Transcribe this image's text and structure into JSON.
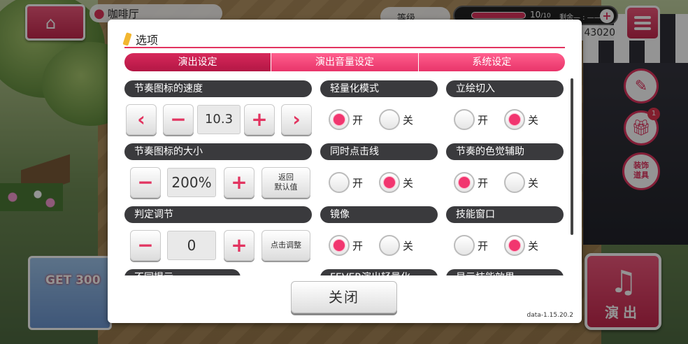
{
  "hud": {
    "location": "咖啡厅",
    "level_label": "等级",
    "stamina": "10",
    "stamina_max": "/10",
    "stamina_rest": "剩余— : ——",
    "coins": "43020",
    "banner_text": "GET 300",
    "side_btn_3": "装饰\n道具",
    "badge_count": "1",
    "perform_label": "演出"
  },
  "dialog": {
    "title": "选项",
    "tabs": [
      {
        "label": "演出设定",
        "active": true
      },
      {
        "label": "演出音量设定",
        "active": false
      },
      {
        "label": "系统设定",
        "active": false
      }
    ],
    "sections": {
      "note_speed": {
        "header": "节奏图标的速度",
        "value": "10.3"
      },
      "note_size": {
        "header": "节奏图标的大小",
        "value": "200%",
        "reset_label_1": "返回",
        "reset_label_2": "默认值"
      },
      "judge_adjust": {
        "header": "判定调节",
        "value": "0",
        "tap_adjust_label": "点击调整"
      },
      "light_mode": {
        "header": "轻量化模式",
        "selected": "on"
      },
      "cutin": {
        "header": "立绘切入",
        "selected": "off"
      },
      "simul_line": {
        "header": "同时点击线",
        "selected": "off"
      },
      "color_assist": {
        "header": "节奏的色觉辅助",
        "selected": "on"
      },
      "mirror": {
        "header": "镜像",
        "selected": "on"
      },
      "skill_window": {
        "header": "技能窗口",
        "selected": "off"
      },
      "row4_a": {
        "header": "不同提示"
      },
      "row4_b": {
        "header": "FEVER演出轻量化"
      },
      "row4_c": {
        "header": "显示技能效果"
      }
    },
    "on_label": "开",
    "off_label": "关",
    "close_label": "关闭",
    "version": "data-1.15.20.2"
  },
  "colors": {
    "accent": "#e8346a",
    "accent_dark": "#b31745",
    "header_bg": "#3a3a3d"
  }
}
